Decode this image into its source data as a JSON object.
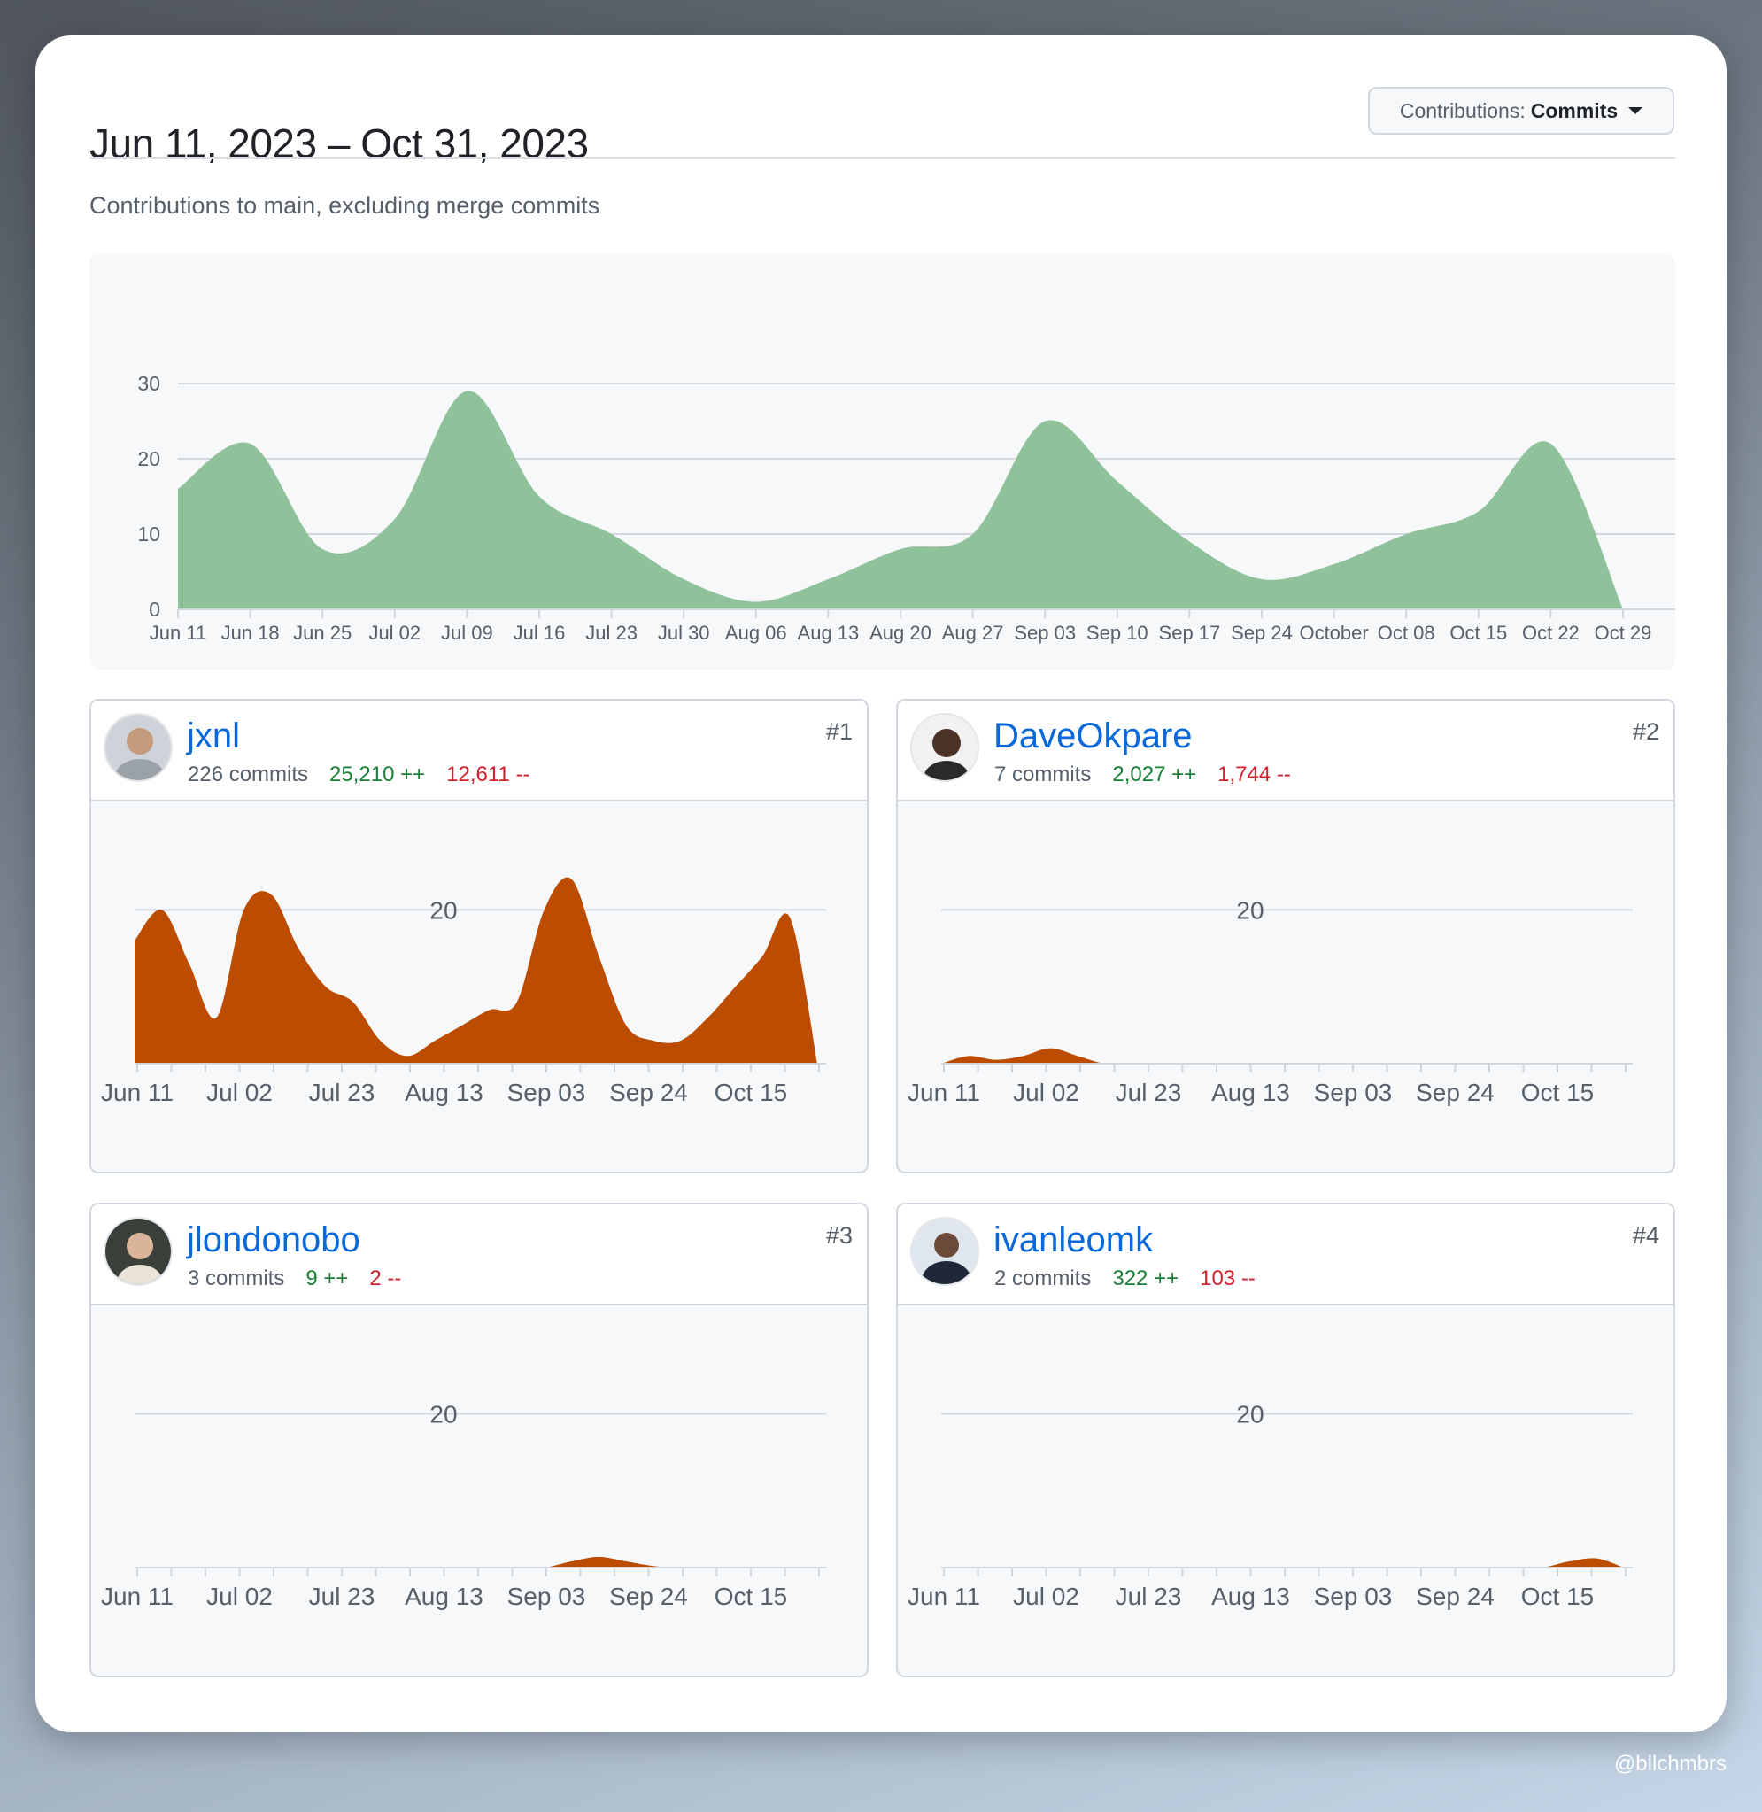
{
  "header": {
    "date_range": "Jun 11, 2023 – Oct 31, 2023",
    "contributions_select": {
      "prefix": "Contributions:",
      "value": "Commits"
    }
  },
  "subtitle": "Contributions to main, excluding merge commits",
  "colors": {
    "main_area": "#8fc19b",
    "contributor_area": "#bc4c00",
    "link": "#0969da",
    "additions": "#1a7f37",
    "deletions": "#cf222e"
  },
  "chart_data": [
    {
      "type": "area",
      "x": [
        "Jun 11",
        "Jun 18",
        "Jun 25",
        "Jul 02",
        "Jul 09",
        "Jul 16",
        "Jul 23",
        "Jul 30",
        "Aug 06",
        "Aug 13",
        "Aug 20",
        "Aug 27",
        "Sep 03",
        "Sep 10",
        "Sep 17",
        "Sep 24",
        "October",
        "Oct 08",
        "Oct 15",
        "Oct 22",
        "Oct 29"
      ],
      "values": [
        16,
        22,
        8,
        12,
        29,
        15,
        10,
        4,
        1,
        4,
        8,
        10,
        25,
        17,
        9,
        4,
        6,
        10,
        13,
        22,
        0
      ],
      "yticks": [
        0,
        10,
        20,
        30
      ],
      "ylim": [
        0,
        30
      ],
      "grid": true
    },
    {
      "type": "area",
      "contributor": "jxnl",
      "values": [
        16,
        20,
        13,
        6,
        20,
        22,
        15,
        10,
        8,
        3,
        1,
        3,
        5,
        7,
        8,
        20,
        24,
        14,
        5,
        3,
        3,
        6,
        10,
        14,
        19,
        0
      ],
      "x_labels": [
        "Jun 11",
        "Jul 02",
        "Jul 23",
        "Aug 13",
        "Sep 03",
        "Sep 24",
        "Oct 15"
      ],
      "ytick": 20,
      "ylim": [
        0,
        22
      ]
    },
    {
      "type": "area",
      "contributor": "DaveOkpare",
      "values": [
        0,
        1,
        0.5,
        1,
        2,
        1,
        0,
        0,
        0,
        0,
        0,
        0,
        0,
        0,
        0,
        0,
        0,
        0,
        0,
        0,
        0,
        0,
        0,
        0,
        0,
        0
      ],
      "x_labels": [
        "Jun 11",
        "Jul 02",
        "Jul 23",
        "Aug 13",
        "Sep 03",
        "Sep 24",
        "Oct 15"
      ],
      "ytick": 20,
      "ylim": [
        0,
        22
      ]
    },
    {
      "type": "area",
      "contributor": "jlondonobo",
      "values": [
        0,
        0,
        0,
        0,
        0,
        0,
        0,
        0,
        0,
        0,
        0,
        0,
        0,
        0,
        0,
        0,
        0.8,
        1.4,
        0.8,
        0.2,
        0,
        0,
        0,
        0,
        0,
        0
      ],
      "x_labels": [
        "Jun 11",
        "Jul 02",
        "Jul 23",
        "Aug 13",
        "Sep 03",
        "Sep 24",
        "Oct 15"
      ],
      "ytick": 20,
      "ylim": [
        0,
        22
      ]
    },
    {
      "type": "area",
      "contributor": "ivanleomk",
      "values": [
        0,
        0,
        0,
        0,
        0,
        0,
        0,
        0,
        0,
        0,
        0,
        0,
        0,
        0,
        0,
        0,
        0,
        0,
        0,
        0,
        0,
        0,
        0,
        0.8,
        1.2,
        0
      ],
      "x_labels": [
        "Jun 11",
        "Jul 02",
        "Jul 23",
        "Aug 13",
        "Sep 03",
        "Sep 24",
        "Oct 15"
      ],
      "ytick": 20,
      "ylim": [
        0,
        22
      ]
    }
  ],
  "contributors": [
    {
      "username": "jxnl",
      "commits": "226 commits",
      "additions": "25,210 ++",
      "deletions": "12,611 --",
      "rank": "#1",
      "avatar_icon": "user-avatar-icon"
    },
    {
      "username": "DaveOkpare",
      "commits": "7 commits",
      "additions": "2,027 ++",
      "deletions": "1,744 --",
      "rank": "#2",
      "avatar_icon": "user-avatar-icon"
    },
    {
      "username": "jlondonobo",
      "commits": "3 commits",
      "additions": "9 ++",
      "deletions": "2 --",
      "rank": "#3",
      "avatar_icon": "user-avatar-icon"
    },
    {
      "username": "ivanleomk",
      "commits": "2 commits",
      "additions": "322 ++",
      "deletions": "103 --",
      "rank": "#4",
      "avatar_icon": "user-avatar-icon"
    }
  ],
  "watermark": "@bllchmbrs"
}
